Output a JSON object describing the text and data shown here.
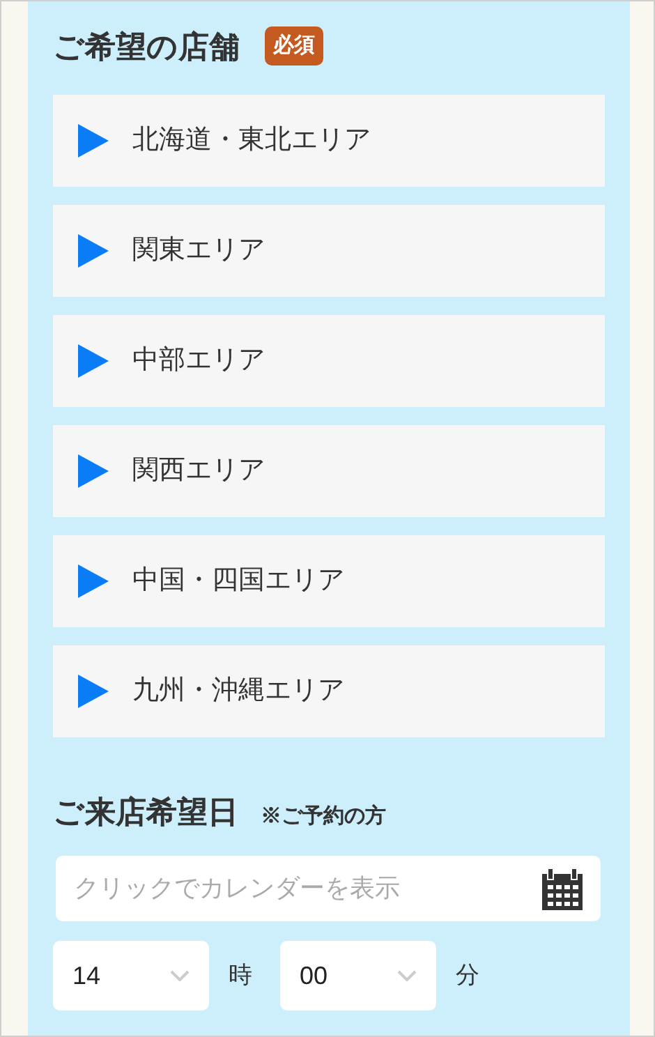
{
  "store_section": {
    "title": "ご希望の店舗",
    "badge": "必須",
    "areas": [
      {
        "label": "北海道・東北エリア",
        "expanded": false
      },
      {
        "label": "関東エリア",
        "expanded": false
      },
      {
        "label": "中部エリア",
        "expanded": false
      },
      {
        "label": "関西エリア",
        "expanded": false
      },
      {
        "label": "中国・四国エリア",
        "expanded": false
      },
      {
        "label": "九州・沖縄エリア",
        "expanded": false
      }
    ]
  },
  "date_section": {
    "title": "ご来店希望日",
    "note": "※ご予約の方",
    "date_field": {
      "placeholder": "クリックでカレンダーを表示"
    },
    "hour": {
      "value": "14",
      "unit": "時"
    },
    "minute": {
      "value": "00",
      "unit": "分"
    }
  }
}
